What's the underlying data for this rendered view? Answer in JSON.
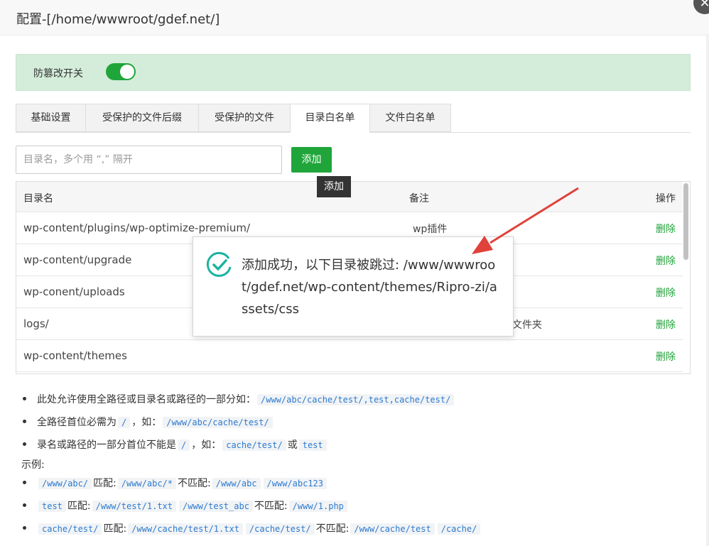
{
  "dialog": {
    "title": "配置-[/home/wwwroot/gdef.net/]"
  },
  "banner": {
    "label": "防篡改开关",
    "toggle_on": true
  },
  "tabs": [
    {
      "label": "基础设置"
    },
    {
      "label": "受保护的文件后缀"
    },
    {
      "label": "受保护的文件"
    },
    {
      "label": "目录白名单",
      "active": true
    },
    {
      "label": "文件白名单"
    }
  ],
  "form": {
    "input_placeholder": "目录名，多个用 “,” 隔开",
    "add_label": "添加",
    "tooltip": "添加"
  },
  "table": {
    "headers": {
      "name": "目录名",
      "note": "备注",
      "op": "操作"
    },
    "rows": [
      {
        "name": "wp-content/plugins/wp-optimize-premium/",
        "note": "wp插件",
        "op": "删除"
      },
      {
        "name": "wp-content/upgrade",
        "note": "",
        "op": "删除"
      },
      {
        "name": "wp-conent/uploads",
        "note": "",
        "op": "删除"
      },
      {
        "name": "logs/",
        "note": "文件夹",
        "op": "删除"
      },
      {
        "name": "wp-content/themes",
        "note": "",
        "op": "删除"
      }
    ]
  },
  "notes": {
    "n1_text": "此处允许使用全路径或目录名或路径的一部分如：",
    "n1_code": "/www/abc/cache/test/,test,cache/test/",
    "n2_text": "全路径首位必需为",
    "n2_code1": "/",
    "n2_mid": "，如：",
    "n2_code2": "/www/abc/cache/test/",
    "n3_text": "录名或路径的一部分首位不能是",
    "n3_code1": "/",
    "n3_mid": "，如：",
    "n3_code2": "cache/test/",
    "n3_or": "或",
    "n3_code3": "test",
    "example_heading": "示例:",
    "ex1_code": "/www/abc/",
    "ex1_match": "匹配:",
    "ex1_m1": "/www/abc/*",
    "ex1_nomatch": "不匹配:",
    "ex1_n1": "/www/abc",
    "ex1_n2": "/www/abc123",
    "ex2_code": "test",
    "ex2_match": "匹配:",
    "ex2_m1": "/www/test/1.txt",
    "ex2_m2": "/www/test_abc",
    "ex2_nomatch": "不匹配:",
    "ex2_n1": "/www/1.php",
    "ex3_code": "cache/test/",
    "ex3_match": "匹配:",
    "ex3_m1": "/www/cache/test/1.txt",
    "ex3_m2": "/cache/test/",
    "ex3_nomatch": "不匹配:",
    "ex3_n1": "/www/cache/test",
    "ex3_n2": "/cache/"
  },
  "toast": {
    "message": "添加成功，以下目录被跳过: /www/wwwroot/gdef.net/wp-content/themes/Ripro-zi/assets/css",
    "icon": "check-circle-icon"
  },
  "colors": {
    "accent": "#20a53a",
    "banner_bg": "#d4edda",
    "arrow": "#e0413a",
    "code": "#2e7bcf"
  }
}
